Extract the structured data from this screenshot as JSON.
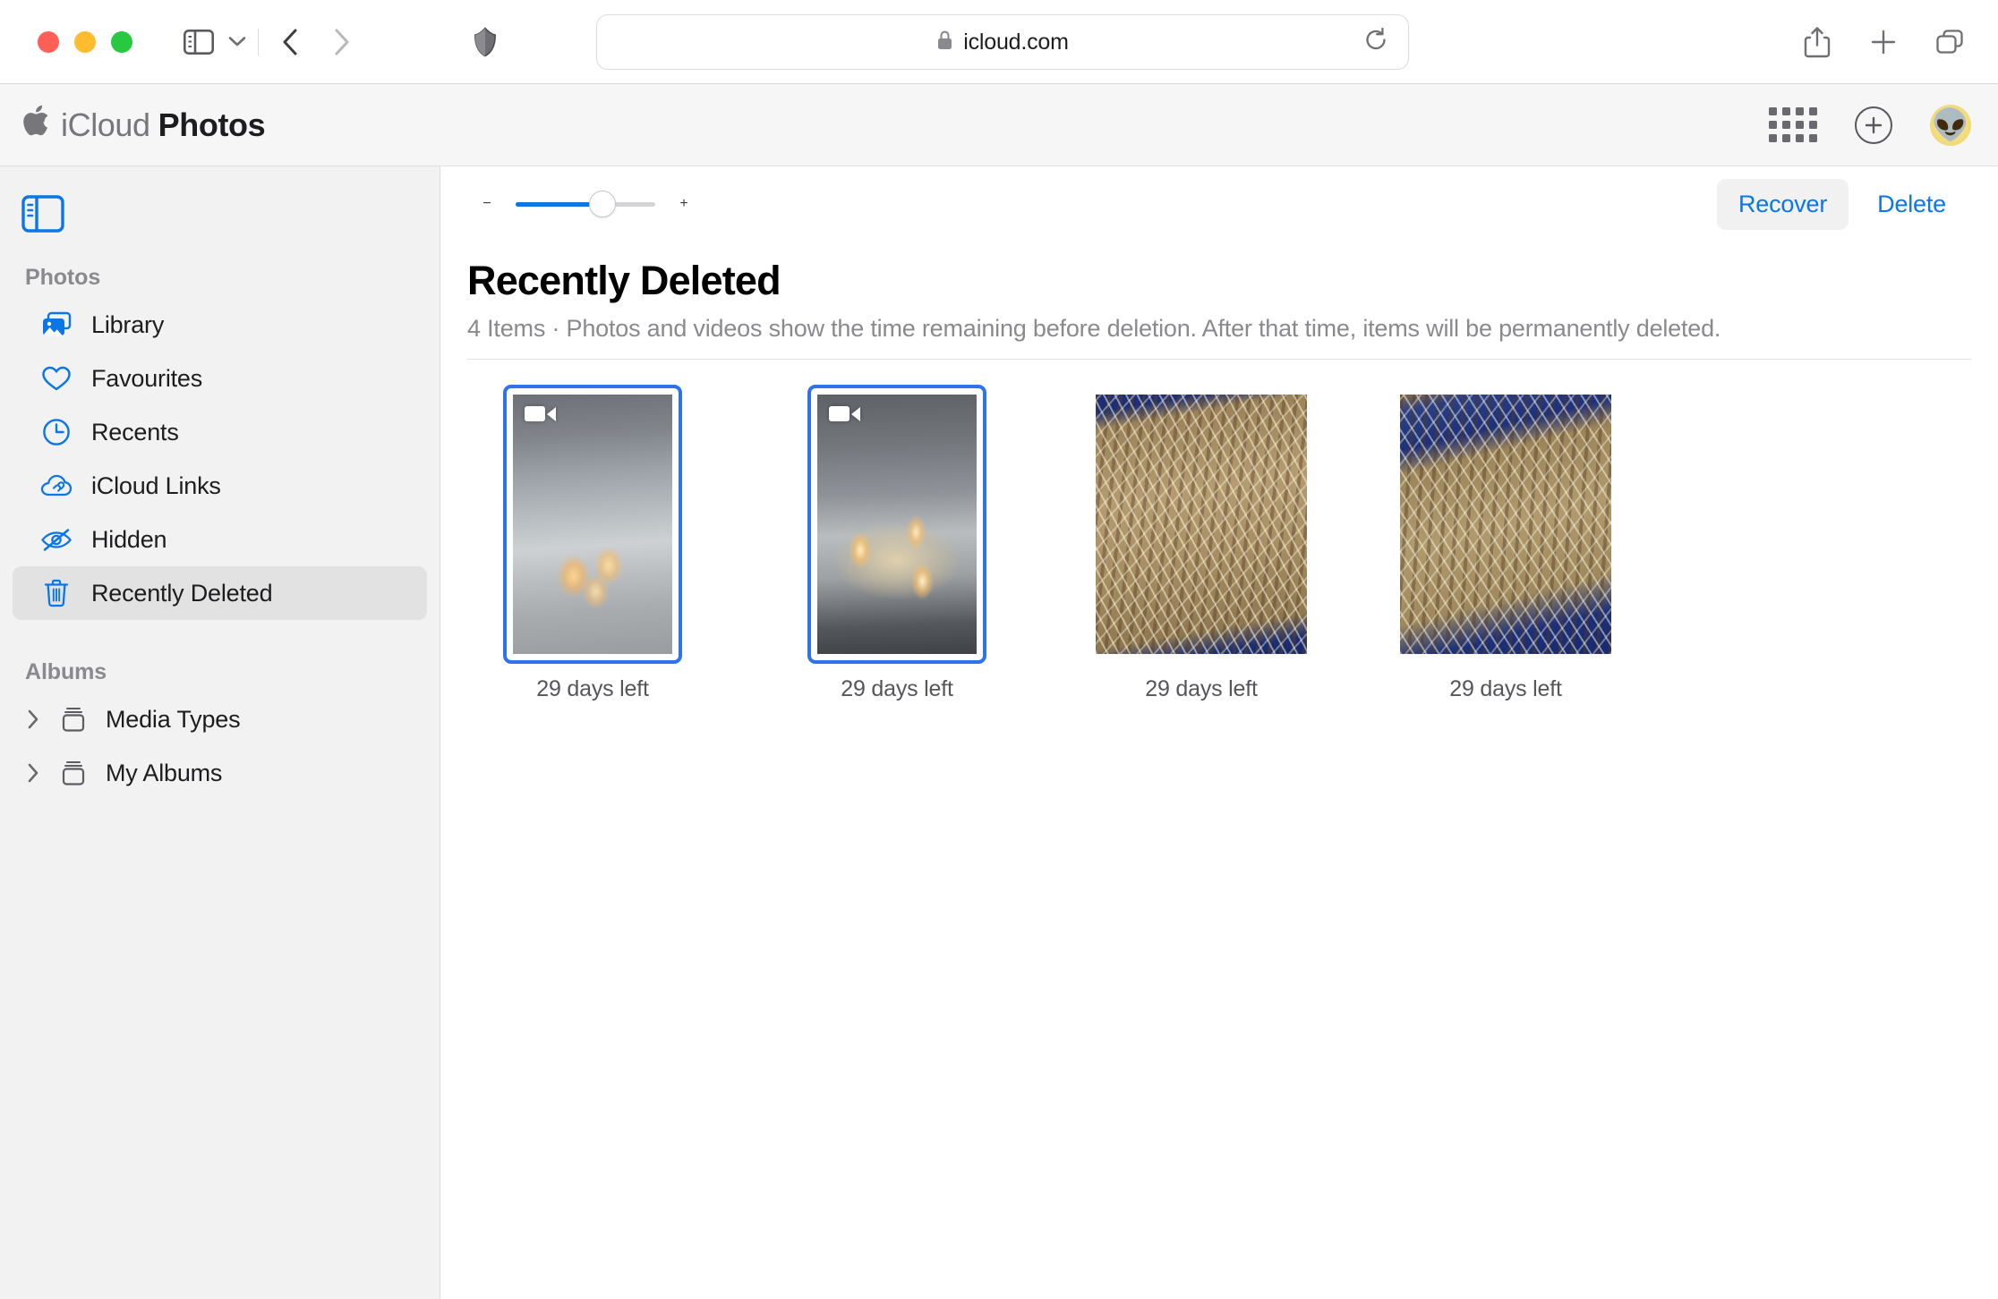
{
  "browser": {
    "traffic_lights": [
      "close",
      "minimize",
      "zoom"
    ],
    "sidebar_toggle": "sidebar-icon",
    "tab_overview_chevron": "chevron-down-icon",
    "back": "back-arrow-icon",
    "forward": "forward-arrow-icon",
    "shield": "privacy-shield-icon",
    "url": "icloud.com",
    "lock": "lock-icon",
    "reload": "reload-icon",
    "share": "share-icon",
    "new_tab": "plus-icon",
    "tabs": "tabs-icon"
  },
  "app_header": {
    "brand_light": "iCloud",
    "brand_bold": "Photos",
    "apple_logo": "apple-logo",
    "app_switcher": "app-grid-icon",
    "add": "plus-circle-icon",
    "avatar_emoji": "👽"
  },
  "sidebar": {
    "toggle_icon": "sidebar-toggle-icon",
    "sections": [
      {
        "title": "Photos",
        "items": [
          {
            "label": "Library",
            "icon": "photos-library-icon",
            "selected": false
          },
          {
            "label": "Favourites",
            "icon": "heart-icon",
            "selected": false
          },
          {
            "label": "Recents",
            "icon": "clock-icon",
            "selected": false
          },
          {
            "label": "iCloud Links",
            "icon": "cloud-link-icon",
            "selected": false
          },
          {
            "label": "Hidden",
            "icon": "eye-slash-icon",
            "selected": false
          },
          {
            "label": "Recently Deleted",
            "icon": "trash-icon",
            "selected": true
          }
        ]
      },
      {
        "title": "Albums",
        "items": [
          {
            "label": "Media Types",
            "icon": "album-stack-icon",
            "expand": "chevron-right-icon"
          },
          {
            "label": "My Albums",
            "icon": "album-stack-icon",
            "expand": "chevron-right-icon"
          }
        ]
      }
    ]
  },
  "toolbar": {
    "zoom_out": "−",
    "zoom_in": "+",
    "zoom_value_percent": 62,
    "recover_label": "Recover",
    "delete_label": "Delete",
    "accent_color": "#0a76e8"
  },
  "content": {
    "title": "Recently Deleted",
    "item_count_label": "4 Items",
    "separator": "·",
    "description": "Photos and videos show the time remaining before deletion. After that time, items will be permanently deleted.",
    "subtitle_full": "4 Items  ·  Photos and videos show the time remaining before deletion. After that time, items will be permanently deleted."
  },
  "photos": [
    {
      "caption": "29 days left",
      "selected": true,
      "is_video": true,
      "orientation": "portrait",
      "alt": "Lit candles floating in a glass bowl against grey rock"
    },
    {
      "caption": "29 days left",
      "selected": true,
      "is_video": true,
      "orientation": "portrait",
      "alt": "Close-up of three lit candles in a glass bowl"
    },
    {
      "caption": "29 days left",
      "selected": false,
      "is_video": false,
      "orientation": "landscape",
      "alt": "Honeycomb kraft paper packaging with wood wool on blue fabric"
    },
    {
      "caption": "29 days left",
      "selected": false,
      "is_video": false,
      "orientation": "landscape",
      "alt": "Kraft paper wrapped parcels with shredded filler in a blue bag"
    }
  ]
}
